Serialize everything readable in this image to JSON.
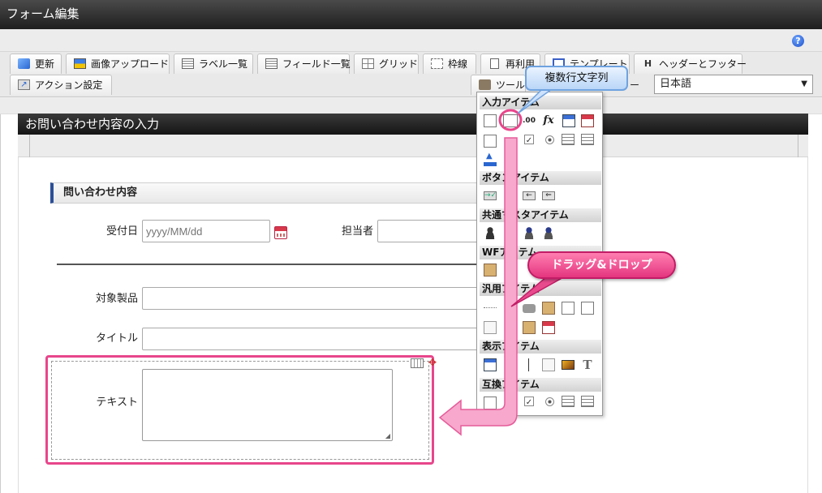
{
  "window": {
    "title": "フォーム編集"
  },
  "toolbar": {
    "update": "更新",
    "image_upload": "画像アップロード",
    "label_list": "ラベル一覧",
    "field_list": "フィールド一覧",
    "grid": "グリッド",
    "frame": "枠線",
    "reuse": "再利用",
    "template": "テンプレート",
    "header_footer": "ヘッダーとフッター",
    "action_settings": "アクション設定",
    "tools": "ツール",
    "tools_suffix": "ー",
    "language": "日本語",
    "help": "?"
  },
  "form": {
    "section_title": "お問い合わせ内容の入力",
    "fieldset_title": "問い合わせ内容",
    "fields": {
      "receipt_date_label": "受付日",
      "receipt_date_placeholder": "yyyy/MM/dd",
      "person_label": "担当者",
      "product_label": "対象製品",
      "title_label": "タイトル",
      "text_label": "テキスト"
    }
  },
  "palette": {
    "sections": [
      "入力アイテム",
      "ボタンアイテム",
      "共通マスタアイテム",
      "WFアイテム",
      "汎用アイテム",
      "表示アイテム",
      "互換アイテム"
    ]
  },
  "callouts": {
    "tooltip": "複数行文字列",
    "drag_drop": "ドラッグ&ドロップ"
  },
  "colors": {
    "highlight": "#e8468b",
    "drag_arrow": "#f7a8cc",
    "tooltip_border": "#6fa3df",
    "section_bar": "#1e1e1e"
  }
}
